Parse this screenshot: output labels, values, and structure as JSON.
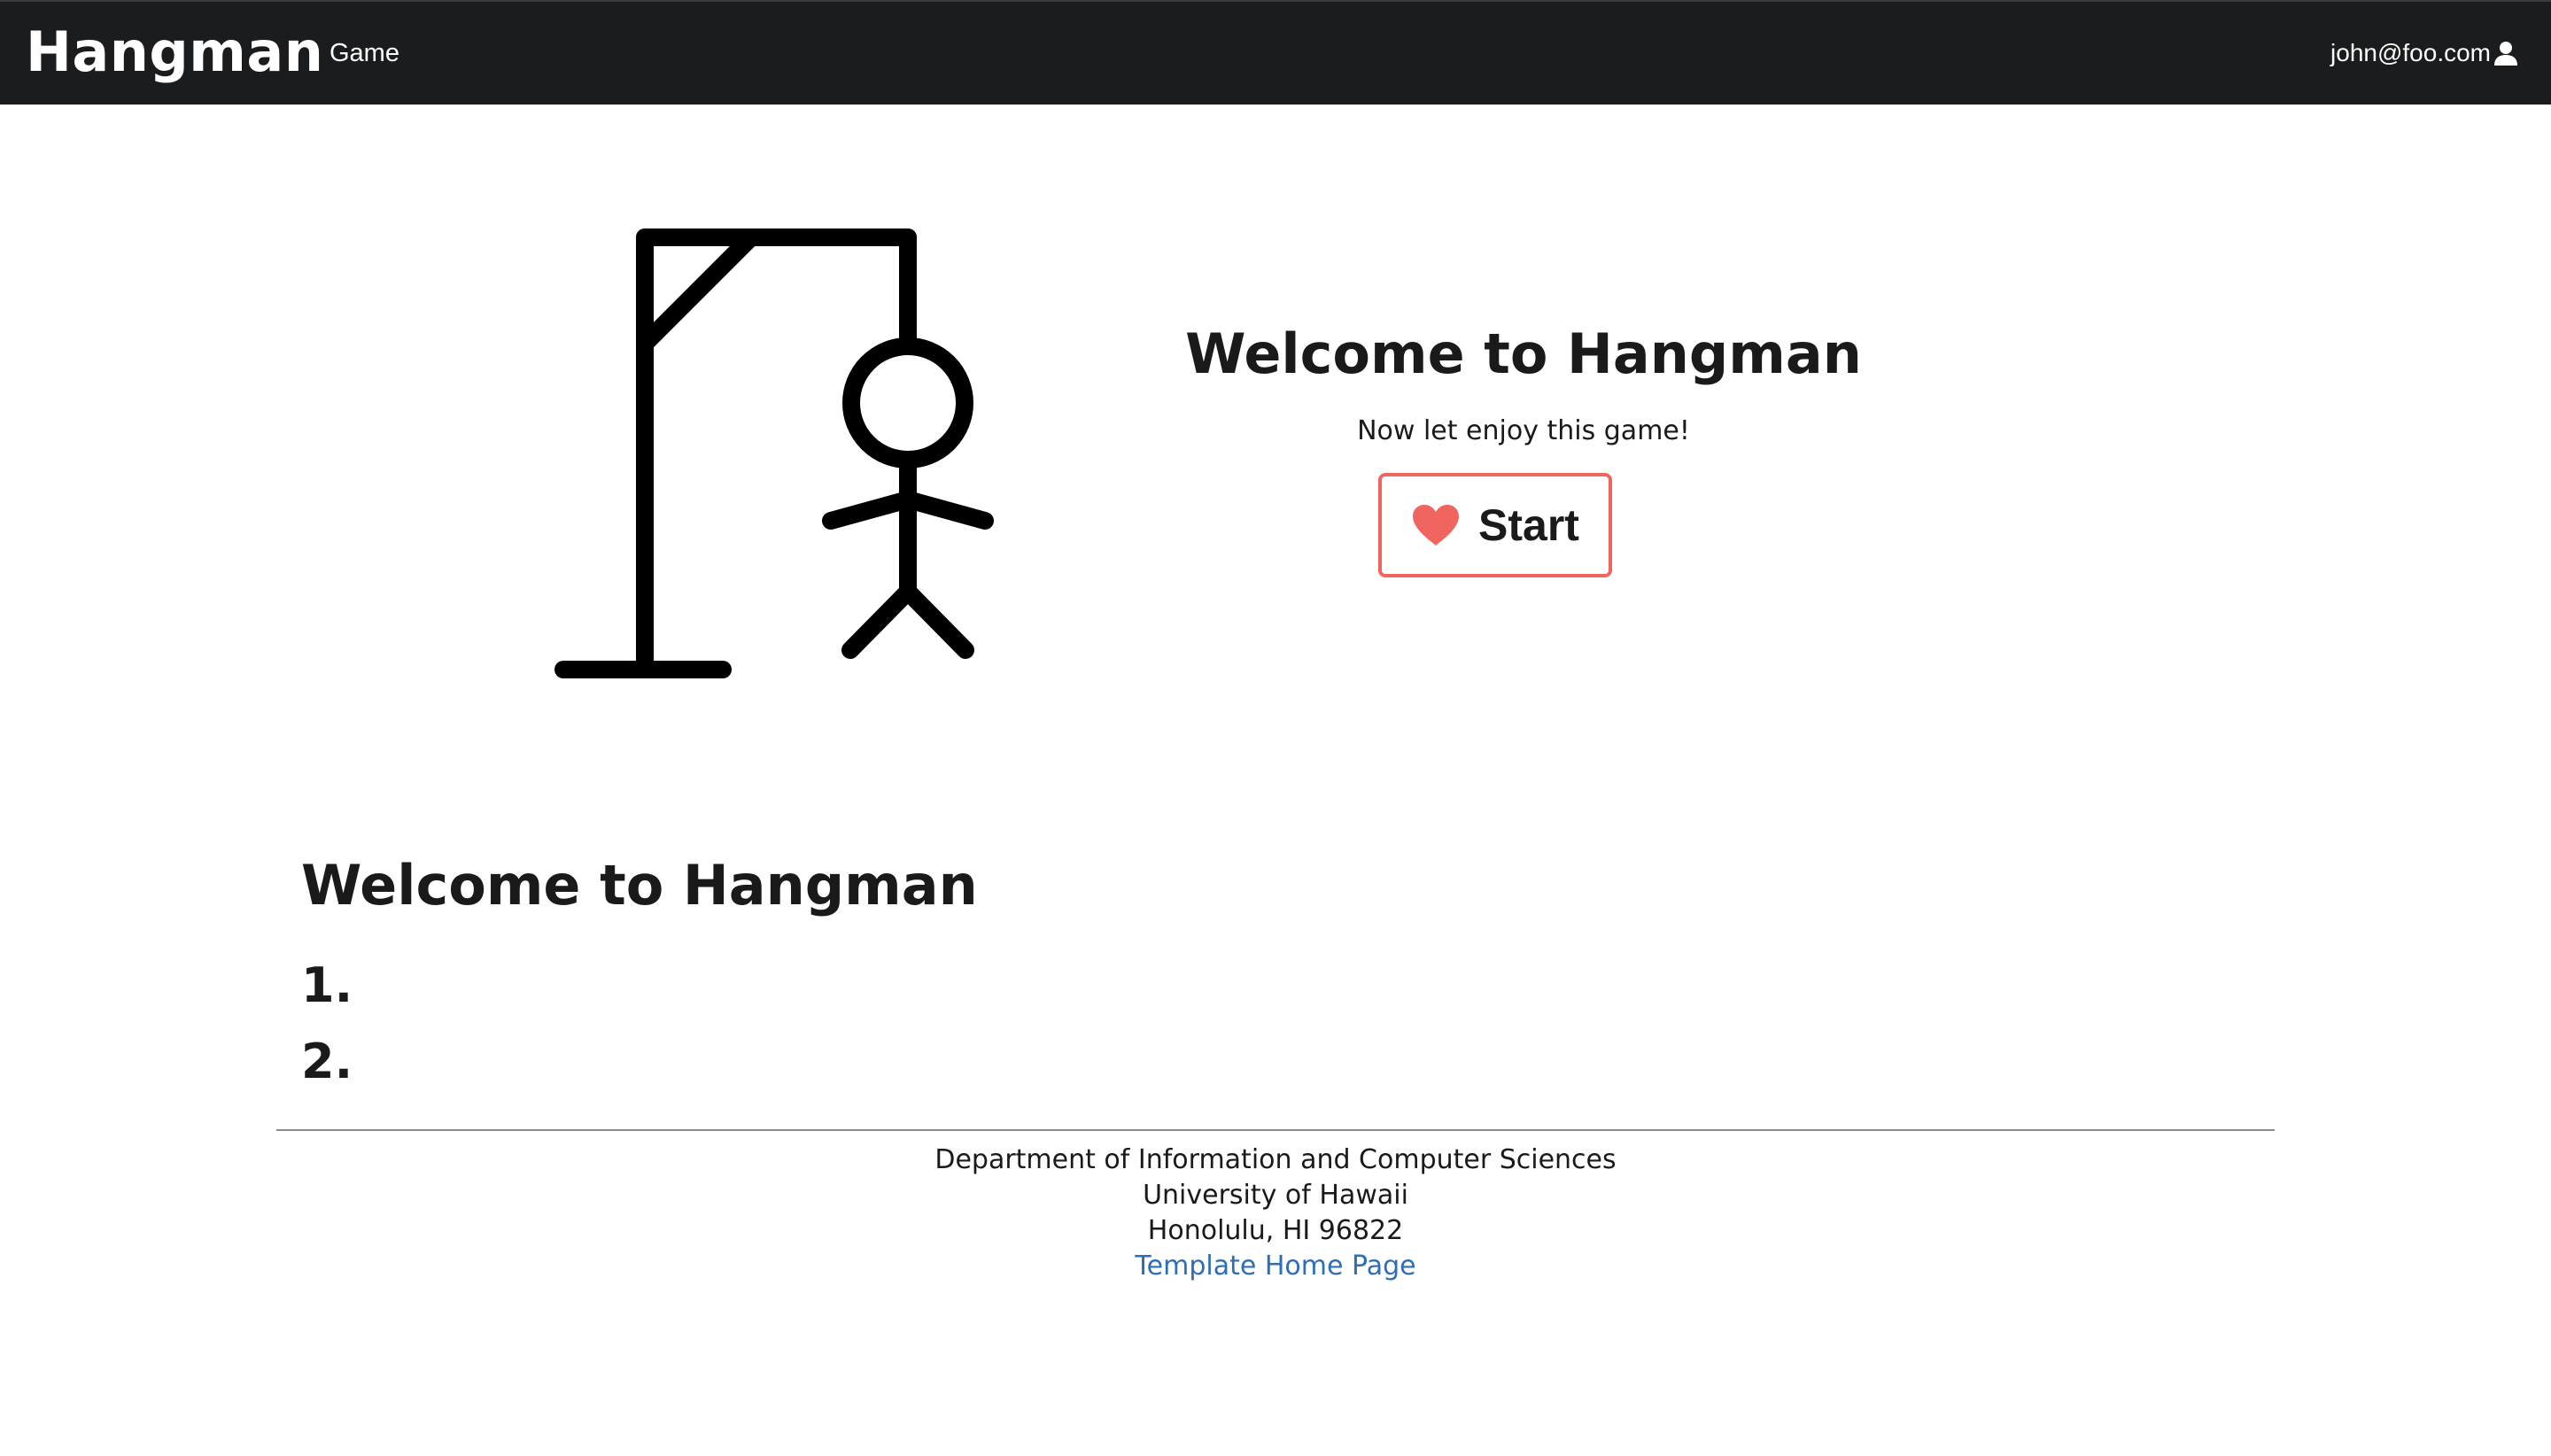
{
  "navbar": {
    "brand": "Hangman",
    "game_link": "Game",
    "user_email": "john@foo.com",
    "user_icon": "user-icon",
    "background": "#1b1c1d"
  },
  "hero": {
    "illustration": "hangman-icon",
    "title": "Welcome to Hangman",
    "subtitle": "Now let enjoy this game!",
    "start_button": {
      "label": "Start",
      "icon": "heart-icon",
      "accent": "#f06560"
    }
  },
  "section": {
    "title": "Welcome to Hangman",
    "items": [
      {
        "marker": "1."
      },
      {
        "marker": "2."
      }
    ]
  },
  "footer": {
    "line1": "Department of Information and Computer Sciences",
    "line2": "University of Hawaii",
    "line3": "Honolulu, HI 96822",
    "link": "Template Home Page",
    "link_color": "#2f6db5"
  }
}
